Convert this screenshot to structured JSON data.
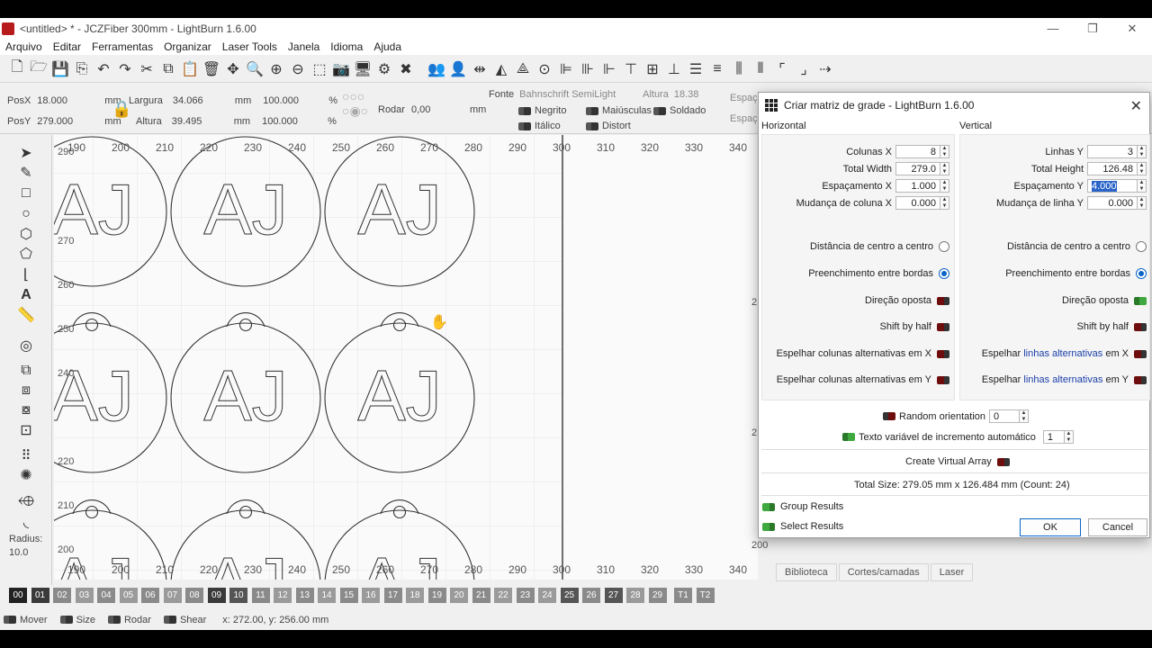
{
  "window": {
    "title": "<untitled> * - JCZFiber 300mm - LightBurn 1.6.00"
  },
  "menu": [
    "Arquivo",
    "Editar",
    "Ferramentas",
    "Organizar",
    "Laser Tools",
    "Janela",
    "Idioma",
    "Ajuda"
  ],
  "props": {
    "posx_label": "PosX",
    "posx": "18.000",
    "posy_label": "PosY",
    "posy": "279.000",
    "unit_mm": "mm",
    "width_label": "Largura",
    "width": "34.066",
    "height_label": "Altura",
    "height": "39.495",
    "scale_x": "100.000",
    "scale_y": "100.000",
    "percent": "%",
    "rotate_label": "Rodar",
    "rotate": "0,00",
    "font_label": "Fonte",
    "font_value": "Bahnschrift SemiLight",
    "font_height_label": "Altura",
    "font_height": "18.38",
    "bold": "Negrito",
    "italic": "Itálico",
    "caps": "Maiúsculas",
    "distort": "Distort",
    "welded": "Soldado",
    "spacing_label": "Espaç"
  },
  "left_tools": {
    "radius_label": "Radius:",
    "radius": "10.0"
  },
  "ruler": {
    "top": [
      "190",
      "200",
      "210",
      "220",
      "230",
      "240",
      "250",
      "260",
      "270",
      "280",
      "290",
      "300",
      "310",
      "320",
      "330",
      "340"
    ],
    "left": [
      "290",
      "270",
      "260",
      "250",
      "240",
      "220",
      "210",
      "200"
    ],
    "right_tick_a": "2",
    "right_tick_b": "2",
    "right_tick_200": "200"
  },
  "canvas": {
    "text": "AJ"
  },
  "dialog": {
    "title": "Criar matriz de grade - LightBurn 1.6.00",
    "horizontal": {
      "heading": "Horizontal",
      "columns_label": "Colunas X",
      "columns": "8",
      "total_width_label": "Total Width",
      "total_width": "279.0",
      "spacing_label": "Espaçamento X",
      "spacing": "1.000",
      "shift_label": "Mudança de coluna X",
      "shift": "0.000",
      "center_label": "Distância de centro a centro",
      "edge_label": "Preenchimento entre bordas",
      "opposite_label": "Direção oposta",
      "half_label": "Shift by half",
      "mirror_x_label": "Espelhar colunas alternativas em X",
      "mirror_y_label": "Espelhar colunas alternativas em Y"
    },
    "vertical": {
      "heading": "Vertical",
      "rows_label": "Linhas Y",
      "rows": "3",
      "total_height_label": "Total Height",
      "total_height": "126.48",
      "spacing_label": "Espaçamento Y",
      "spacing": "4.000",
      "shift_label": "Mudança de linha Y",
      "shift": "0.000",
      "center_label": "Distância de centro a centro",
      "edge_label": "Preenchimento entre bordas",
      "opposite_label": "Direção oposta",
      "half_label": "Shift by half",
      "mirror_prefix": "Espelhar ",
      "mirror_link": "linhas alternativas",
      "mirror_x_suffix": " em X",
      "mirror_y_suffix": " em Y"
    },
    "random_label": "Random orientation",
    "random": "0",
    "variable_label": "Texto variável de incremento automático",
    "variable": "1",
    "virtual_label": "Create Virtual Array",
    "total_size": "Total Size: 279.05 mm x 126.484 mm  (Count: 24)",
    "group_results": "Group Results",
    "select_results": "Select Results",
    "ok": "OK",
    "cancel": "Cancel"
  },
  "right_tabs": [
    "Biblioteca",
    "Cortes/camadas",
    "Laser"
  ],
  "palette": [
    "00",
    "01",
    "02",
    "03",
    "04",
    "05",
    "06",
    "07",
    "08",
    "09",
    "10",
    "11",
    "12",
    "13",
    "14",
    "15",
    "16",
    "17",
    "18",
    "19",
    "20",
    "21",
    "22",
    "23",
    "24",
    "25",
    "26",
    "27",
    "28",
    "29",
    "T1",
    "T2"
  ],
  "palette_colors": [
    "#222222",
    "#3a3a3a",
    "#8a8a8a",
    "#9a9a9a",
    "#8a8a8a",
    "#9a9a9a",
    "#8a8a8a",
    "#9a9a9a",
    "#8a8a8a",
    "#3a3a3a",
    "#555555",
    "#8a8a8a",
    "#9a9a9a",
    "#8a8a8a",
    "#9a9a9a",
    "#8a8a8a",
    "#9a9a9a",
    "#8a8a8a",
    "#9a9a9a",
    "#8a8a8a",
    "#9a9a9a",
    "#8a8a8a",
    "#9a9a9a",
    "#8a8a8a",
    "#9a9a9a",
    "#555555",
    "#8a8a8a",
    "#555555",
    "#9a9a9a",
    "#8a8a8a",
    "#8a8a8a",
    "#8a8a8a"
  ],
  "status": {
    "move": "Mover",
    "size": "Size",
    "rotate": "Rodar",
    "shear": "Shear",
    "coords": "x: 272.00, y: 256.00 mm"
  }
}
